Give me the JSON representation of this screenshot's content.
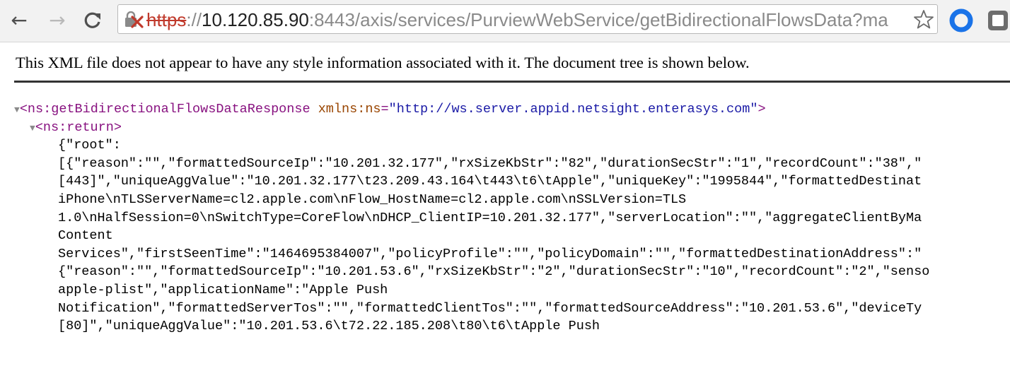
{
  "browser": {
    "nav": {
      "back_glyph": "←",
      "forward_glyph": "→",
      "reload_glyph": "C"
    },
    "url": {
      "scheme": "https",
      "separator": "://",
      "host": "10.120.85.90",
      "rest": ":8443/axis/services/PurviewWebService/getBidirectionalFlowsData?ma"
    },
    "icons": [
      "back-arrow-icon",
      "forward-arrow-icon",
      "reload-icon",
      "insecure-lock-icon",
      "bookmark-star-icon",
      "extension-icon",
      "extension-icon"
    ],
    "colors": {
      "insecure": "#c0392b",
      "extension_blue": "#1a73e8"
    }
  },
  "page": {
    "notice": "This XML file does not appear to have any style information associated with it. The document tree is shown below.",
    "tree": {
      "root_open_tag": "<ns:getBidirectionalFlowsDataResponse",
      "root_attr_name": "xmlns:ns",
      "root_attr_eq": "=",
      "root_attr_value": "\"http://ws.server.appid.netsight.enterasys.com\"",
      "root_close_bracket": ">",
      "return_tag": "<ns:return>",
      "toggle_glyph": "▼",
      "content_lines": [
        "{\"root\":",
        "[{\"reason\":\"\",\"formattedSourceIp\":\"10.201.32.177\",\"rxSizeKbStr\":\"82\",\"durationSecStr\":\"1\",\"recordCount\":\"38\",\"",
        "[443]\",\"uniqueAggValue\":\"10.201.32.177\\t23.209.43.164\\t443\\t6\\tApple\",\"uniqueKey\":\"1995844\",\"formattedDestinat",
        "iPhone\\nTLSServerName=cl2.apple.com\\nFlow_HostName=cl2.apple.com\\nSSLVersion=TLS",
        "1.0\\nHalfSession=0\\nSwitchType=CoreFlow\\nDHCP_ClientIP=10.201.32.177\",\"serverLocation\":\"\",\"aggregateClientByMa",
        "Content",
        "Services\",\"firstSeenTime\":\"1464695384007\",\"policyProfile\":\"\",\"policyDomain\":\"\",\"formattedDestinationAddress\":\"",
        "{\"reason\":\"\",\"formattedSourceIp\":\"10.201.53.6\",\"rxSizeKbStr\":\"2\",\"durationSecStr\":\"10\",\"recordCount\":\"2\",\"senso",
        "apple-plist\",\"applicationName\":\"Apple Push",
        "Notification\",\"formattedServerTos\":\"\",\"formattedClientTos\":\"\",\"formattedSourceAddress\":\"10.201.53.6\",\"deviceTy",
        "[80]\",\"uniqueAggValue\":\"10.201.53.6\\t72.22.185.208\\t80\\t6\\tApple Push"
      ]
    }
  }
}
